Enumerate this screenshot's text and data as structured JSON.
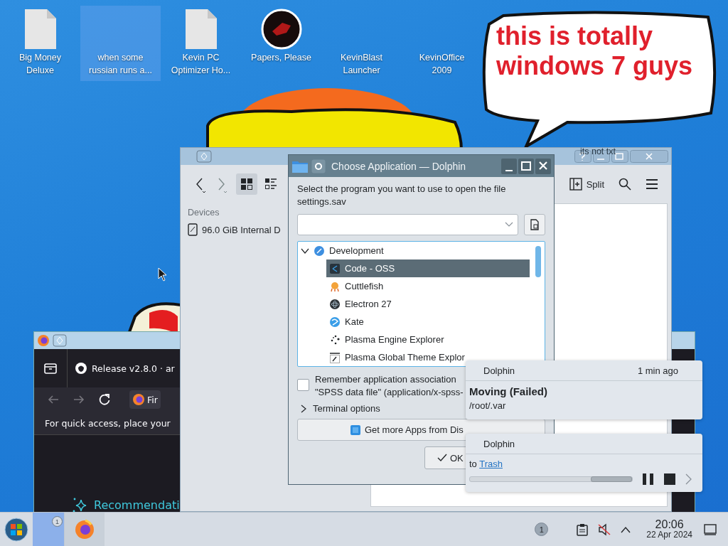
{
  "desktop_icons": [
    {
      "label": "Big Money Deluxe",
      "kind": "file",
      "selected": false
    },
    {
      "label": "when some russian runs a...",
      "kind": "blank",
      "selected": true
    },
    {
      "label": "Kevin PC Optimizer Ho...",
      "kind": "file",
      "selected": false
    },
    {
      "label": "Papers, Please",
      "kind": "game",
      "selected": false
    },
    {
      "label": "KevinBlast Launcher",
      "kind": "blank",
      "selected": false
    },
    {
      "label": "KevinOffice 2009",
      "kind": "blank",
      "selected": false
    }
  ],
  "speech_bubble": {
    "text": "this is totally windows 7 guys"
  },
  "file_manager": {
    "title": "its not txt",
    "split_button": "Split",
    "places_heading": "Devices",
    "places": [
      {
        "label": "96.0 GiB Internal D"
      }
    ]
  },
  "browser": {
    "tab": "Release v2.8.0 · ar",
    "url_button": "Fir",
    "bookmarks_hint": "For quick access, place your",
    "recommendations": "Recommendati"
  },
  "dialog": {
    "title": "Choose Application — Dolphin",
    "prompt": "Select the program you want to use to open the file settings.sav",
    "app_tree": [
      {
        "label": "Development",
        "kind": "globe",
        "expanded": true,
        "selected": false,
        "children": [
          {
            "label": "Code - OSS",
            "kind": "code",
            "selected": true
          },
          {
            "label": "Cuttlefish",
            "kind": "fish",
            "selected": false
          },
          {
            "label": "Electron 27",
            "kind": "atom",
            "selected": false
          },
          {
            "label": "Kate",
            "kind": "kate",
            "selected": false
          },
          {
            "label": "Plasma Engine Explorer",
            "kind": "dots",
            "selected": false
          },
          {
            "label": "Plasma Global Theme Explor",
            "kind": "theme",
            "selected": false
          }
        ]
      }
    ],
    "remember": {
      "label": "Remember application association",
      "label_2": "\"SPSS data file\" (application/x-spss-",
      "checked": false
    },
    "terminal_options": {
      "label": "Terminal options",
      "expanded": false
    },
    "discover_button": "Get more Apps from Dis",
    "buttons": [
      {
        "label": "OK",
        "kind": "ok"
      }
    ]
  },
  "notifications": [
    {
      "kind": "failed",
      "app": "Dolphin",
      "time": "1 min ago",
      "title": "Moving (Failed)",
      "body": "/root/.var"
    },
    {
      "kind": "job",
      "app": "Dolphin",
      "body": "to",
      "link": "Trash"
    }
  ],
  "taskbar": {
    "pager_badge": "1",
    "tray_badge": "1",
    "muted": true,
    "time": "20:06",
    "date": "22 Apr 2024"
  }
}
